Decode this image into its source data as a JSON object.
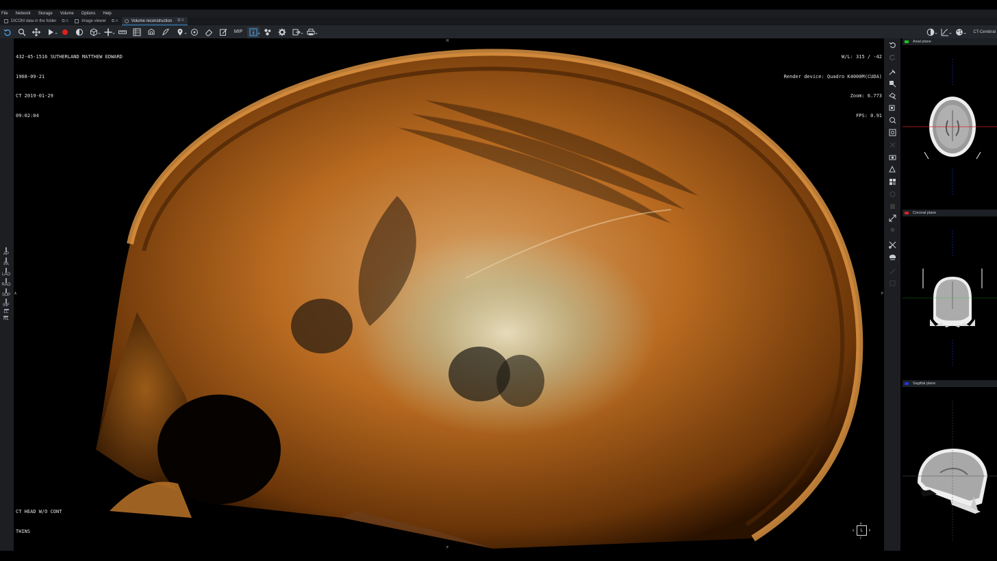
{
  "menu": [
    "File",
    "Network",
    "Storage",
    "Volume",
    "Options",
    "Help"
  ],
  "tabs": [
    {
      "label": "DICOM data in the folder",
      "active": false
    },
    {
      "label": "Image viewer",
      "active": false
    },
    {
      "label": "Volume reconstruction",
      "active": true
    }
  ],
  "toolbar": {
    "mip_label": "MIP",
    "preset_label": "CT-Cerebral",
    "icons": [
      "undo-icon",
      "magnifier-icon",
      "pan-icon",
      "play-icon",
      "record-icon",
      "contrast-icon",
      "cube-icon",
      "move-icon",
      "ruler-icon",
      "layers-icon",
      "crop-icon",
      "sculpt-icon",
      "brush-icon",
      "pin-icon",
      "target-icon",
      "eraser-icon",
      "edit-icon",
      "mip-button",
      "info-icon",
      "segment-icon",
      "settings-icon",
      "export-icon",
      "print-icon"
    ]
  },
  "orientation": [
    "AP",
    "PA",
    "LAO",
    "RAO",
    "SUP",
    "INF",
    "LL",
    "RL"
  ],
  "overlay": {
    "top_left": [
      "432-45-1516 SUTHERLAND MATTHEW EDWARD",
      "1968-09-21",
      "CT 2019-01-29",
      "09:02:04"
    ],
    "top_right": [
      "W/L: 315 / -42",
      "Render device: Quadro K4000M(CUDA)",
      "Zoom: 6.773",
      "FPS: 0.91"
    ],
    "bottom_left": [
      "CT HEAD W/O CONT",
      "THINS"
    ],
    "cube_label": "L",
    "cube_marks": {
      "top": "H",
      "left": "A",
      "right": "P",
      "bottom": "F"
    },
    "edge_marks": {
      "top": "H",
      "bottom": "F",
      "left": "A",
      "right": "P"
    }
  },
  "panels": [
    {
      "title": "Axial plane",
      "color": "#1ec21e"
    },
    {
      "title": "Coronal plane",
      "color": "#d42020"
    },
    {
      "title": "Sagittal plane",
      "color": "#2035d4"
    }
  ],
  "colors": {
    "accent": "#3a8fd6",
    "bone": "#c8741c",
    "record": "#e02020"
  }
}
